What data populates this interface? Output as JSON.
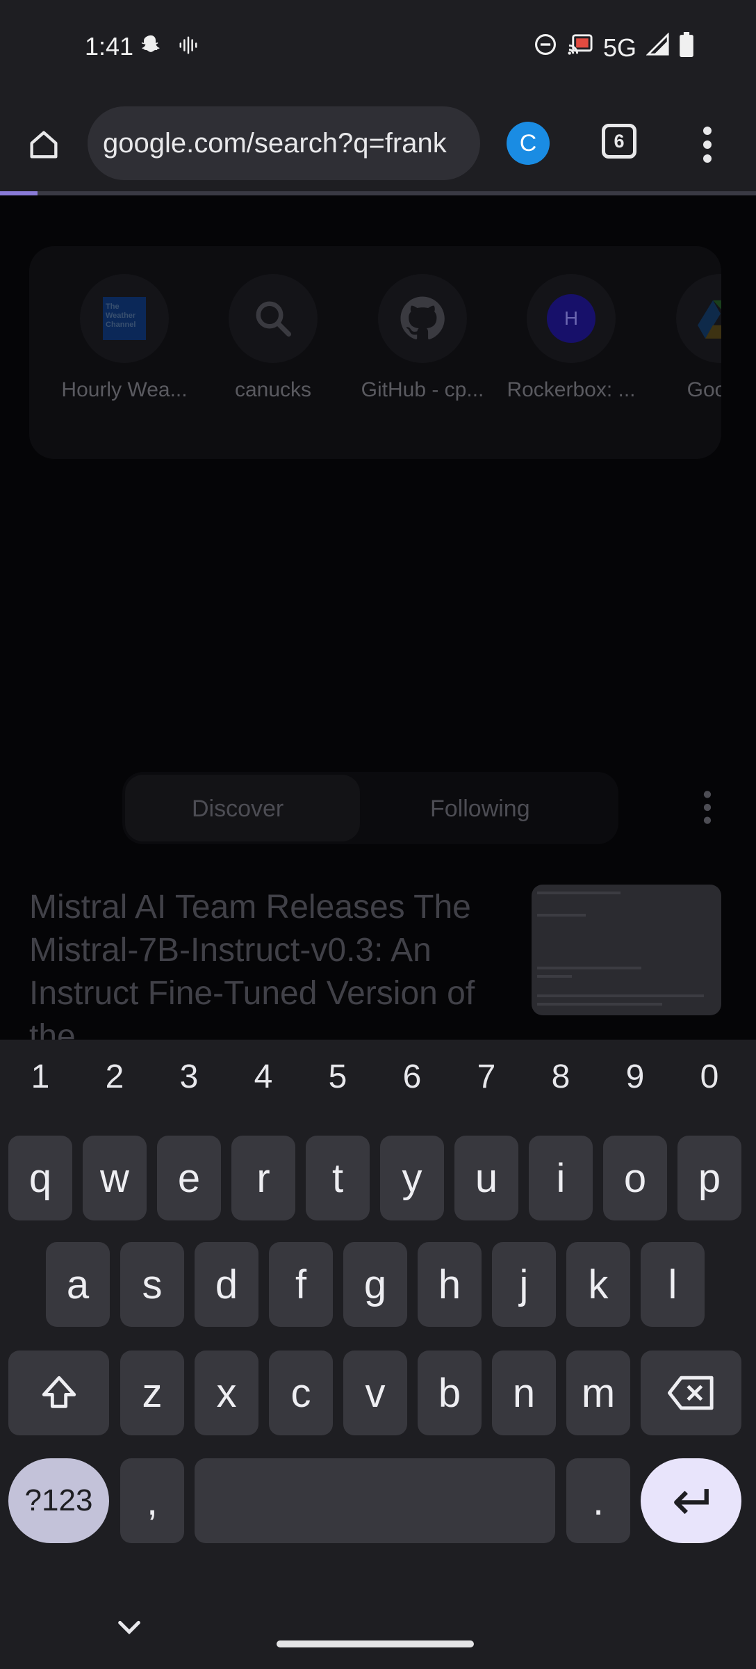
{
  "status_bar": {
    "time": "1:41",
    "network": "5G",
    "left_icons": [
      "snapchat-icon",
      "voice-activity-icon"
    ],
    "right_icons": [
      "do-not-disturb-icon",
      "cast-icon",
      "signal-icon",
      "battery-icon"
    ]
  },
  "toolbar": {
    "url": "google.com/search?q=frank",
    "avatar_letter": "C",
    "tab_count": "6",
    "page_load_progress": 0.05
  },
  "shortcuts": [
    {
      "label": "Hourly Wea...",
      "icon": "weather-channel-icon"
    },
    {
      "label": "canucks",
      "icon": "search-icon"
    },
    {
      "label": "GitHub - cp...",
      "icon": "github-icon"
    },
    {
      "label": "Rockerbox: ...",
      "icon": "rockerbox-icon",
      "letter": "H"
    },
    {
      "label": "Google",
      "icon": "google-drive-icon"
    }
  ],
  "weather_logo_text": "The Weather Channel",
  "feed": {
    "tabs": [
      "Discover",
      "Following"
    ],
    "active_tab": "Discover",
    "article_title": "Mistral AI Team Releases The Mistral-7B-Instruct-v0.3: An Instruct Fine-Tuned Version of the"
  },
  "keyboard": {
    "numbers": [
      "1",
      "2",
      "3",
      "4",
      "5",
      "6",
      "7",
      "8",
      "9",
      "0"
    ],
    "row1": [
      "q",
      "w",
      "e",
      "r",
      "t",
      "y",
      "u",
      "i",
      "o",
      "p"
    ],
    "row2": [
      "a",
      "s",
      "d",
      "f",
      "g",
      "h",
      "j",
      "k",
      "l"
    ],
    "row3": [
      "z",
      "x",
      "c",
      "v",
      "b",
      "n",
      "m"
    ],
    "symbols_label": "?123",
    "comma": ",",
    "period": "."
  }
}
